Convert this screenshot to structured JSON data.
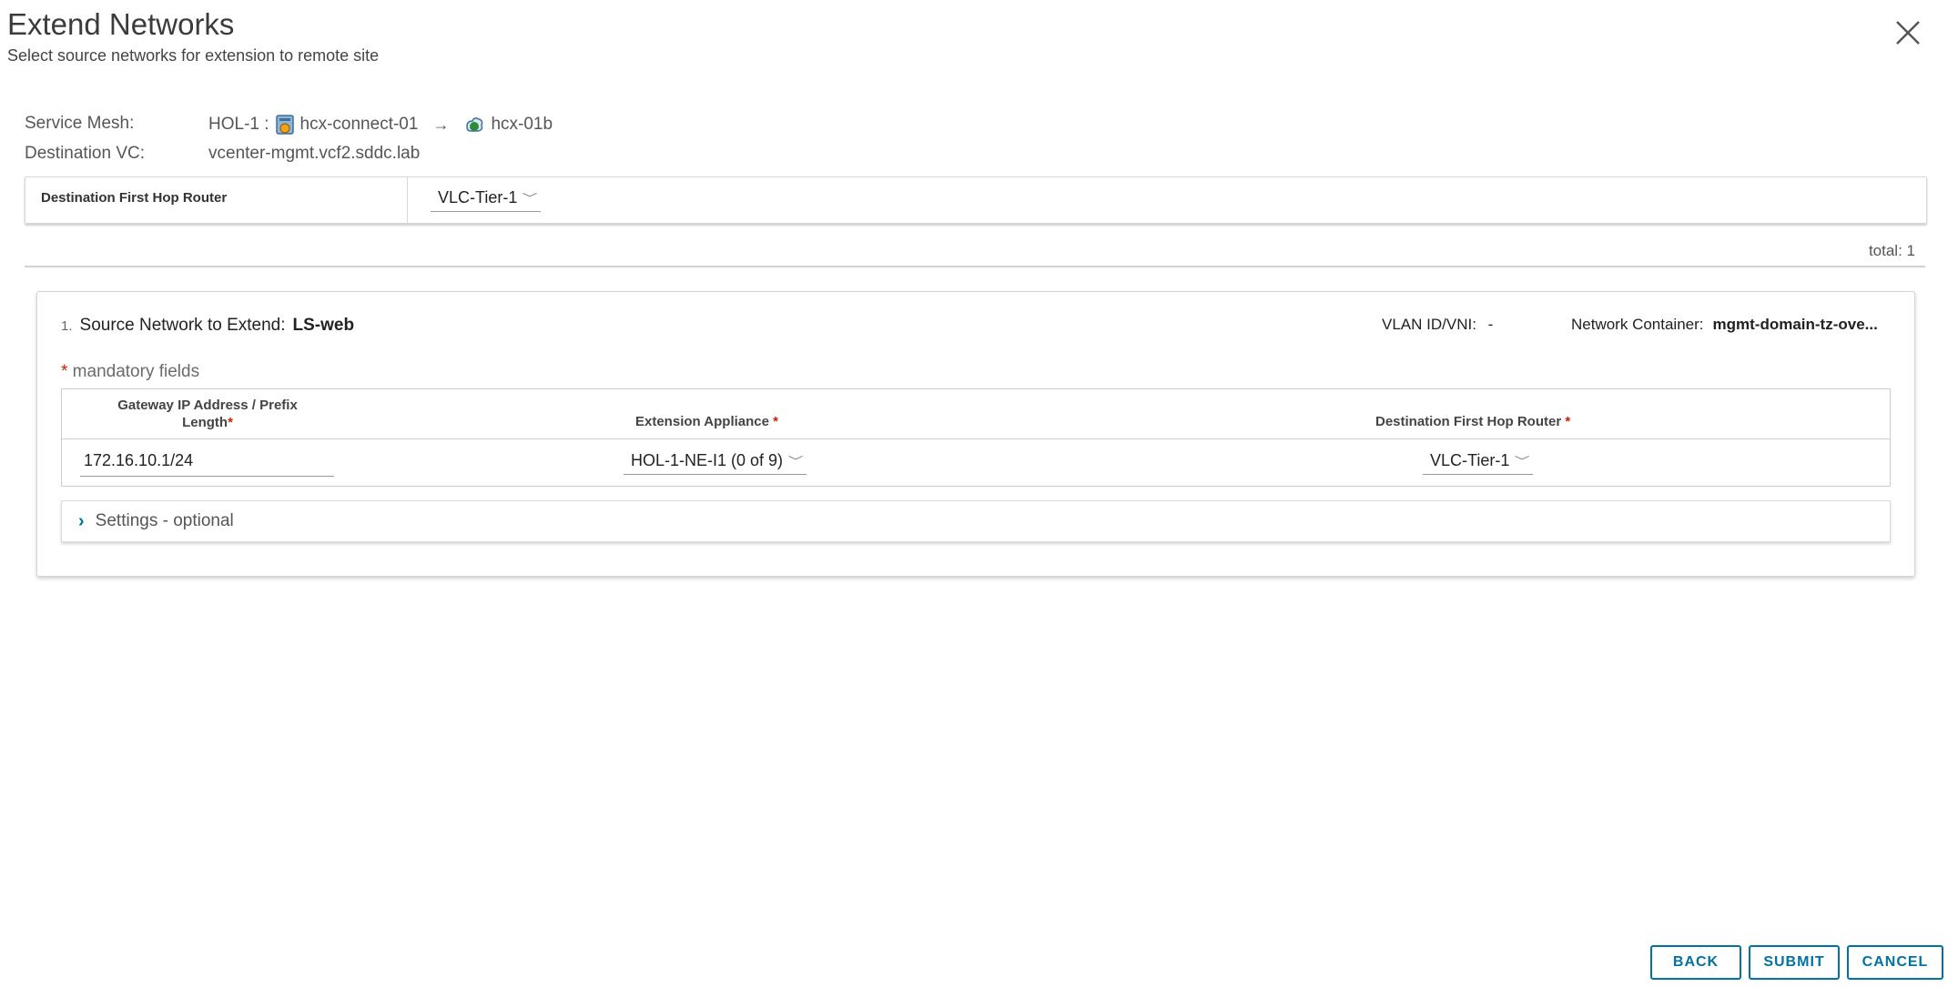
{
  "dialog": {
    "title": "Extend Networks",
    "subtitle": "Select source networks for extension to remote site"
  },
  "service_mesh": {
    "label": "Service Mesh:",
    "mesh_name": "HOL-1 :",
    "source_site": "hcx-connect-01",
    "arrow": "→",
    "dest_site": "hcx-01b"
  },
  "destination_vc": {
    "label": "Destination VC:",
    "value": "vcenter-mgmt.vcf2.sddc.lab"
  },
  "first_hop": {
    "label": "Destination First Hop Router",
    "value": "VLC-Tier-1"
  },
  "total": "total: 1",
  "network": {
    "index": "1.",
    "label": "Source Network to Extend:",
    "name": "LS-web",
    "vlan_label": "VLAN ID/VNI:",
    "vlan_value": "-",
    "container_label": "Network Container:",
    "container_value": "mgmt-domain-tz-ove...",
    "mandatory_star": "*",
    "mandatory_text": " mandatory fields",
    "columns": {
      "gateway_line1": "Gateway IP Address / Prefix",
      "gateway_line2": "Length",
      "appliance": "Extension Appliance",
      "router": "Destination First Hop Router",
      "required": "*"
    },
    "gateway_value": "172.16.10.1/24",
    "appliance_value": "HOL-1-NE-I1 (0 of 9)",
    "router_value": "VLC-Tier-1",
    "settings_label": "Settings - optional"
  },
  "buttons": {
    "back": "BACK",
    "submit": "SUBMIT",
    "cancel": "CANCEL"
  },
  "colors": {
    "accent": "#0072a3",
    "required": "#c92100"
  }
}
